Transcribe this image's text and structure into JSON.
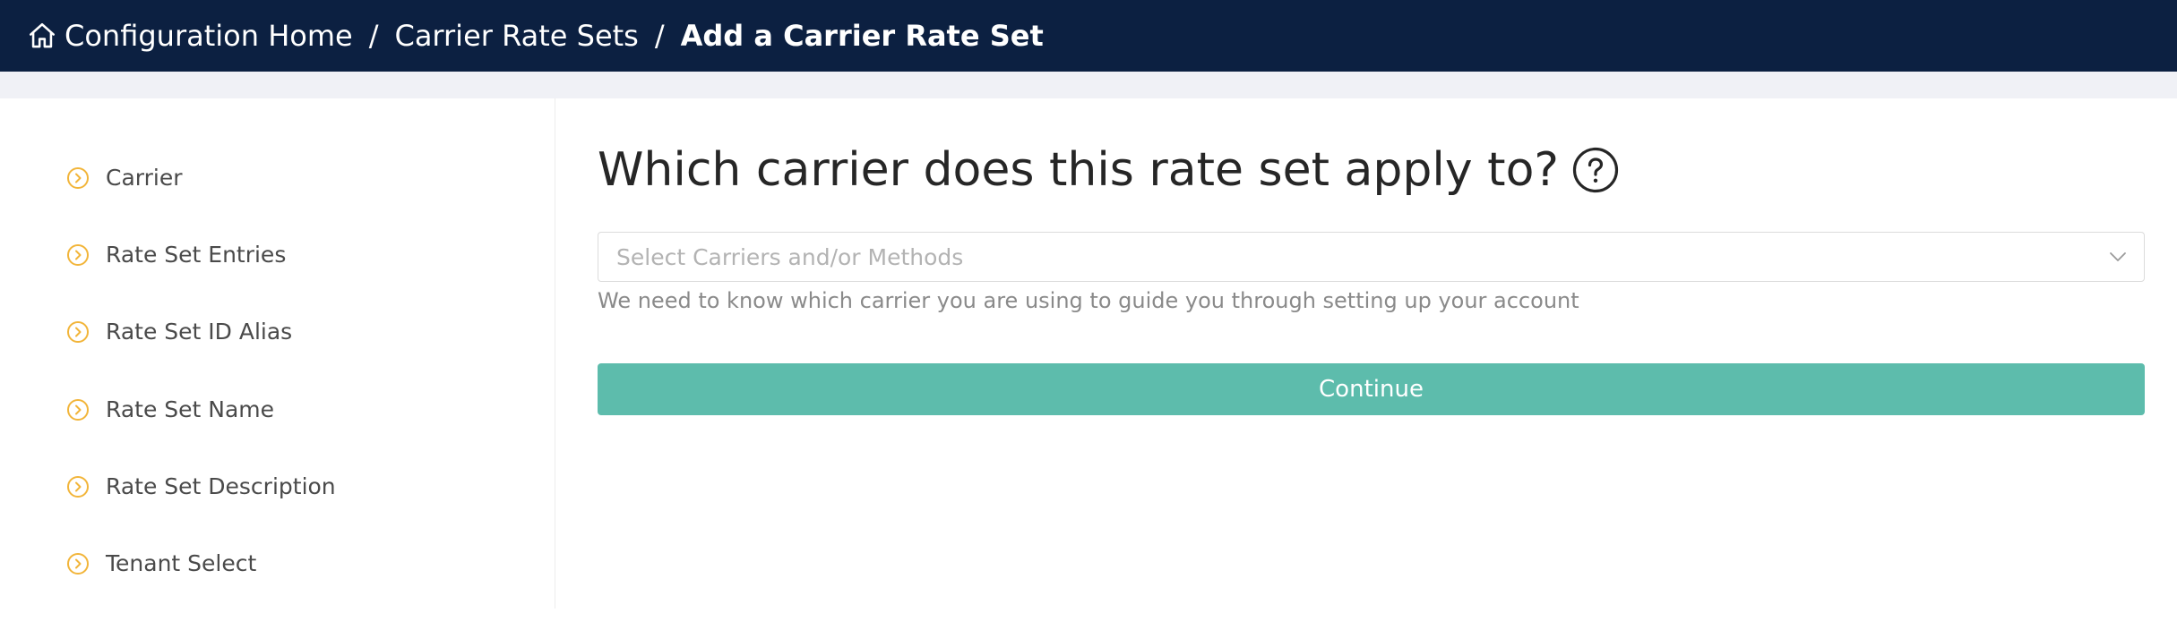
{
  "header": {
    "breadcrumb": {
      "home_label": "Configuration Home",
      "separator": "/",
      "parent_label": "Carrier Rate Sets",
      "current_label": "Add a Carrier Rate Set"
    },
    "icons": {
      "home": "home-icon"
    }
  },
  "sidebar": {
    "items": [
      {
        "label": "Carrier",
        "icon": "chevron-right-circle-icon"
      },
      {
        "label": "Rate Set Entries",
        "icon": "chevron-right-circle-icon"
      },
      {
        "label": "Rate Set ID Alias",
        "icon": "chevron-right-circle-icon"
      },
      {
        "label": "Rate Set Name",
        "icon": "chevron-right-circle-icon"
      },
      {
        "label": "Rate Set Description",
        "icon": "chevron-right-circle-icon"
      },
      {
        "label": "Tenant Select",
        "icon": "chevron-right-circle-icon"
      }
    ]
  },
  "main": {
    "question": "Which carrier does this rate set apply to?",
    "carrier_select": {
      "placeholder": "Select Carriers and/or Methods",
      "icon": "chevron-down-icon"
    },
    "helper_text": "We need to know which carrier you are using to guide you through setting up your account",
    "continue_label": "Continue"
  },
  "colors": {
    "header_bg": "#0c2041",
    "subheader_bg": "#f0f1f6",
    "step_icon": "#f2b53a",
    "continue_bg": "#5dbcac"
  }
}
